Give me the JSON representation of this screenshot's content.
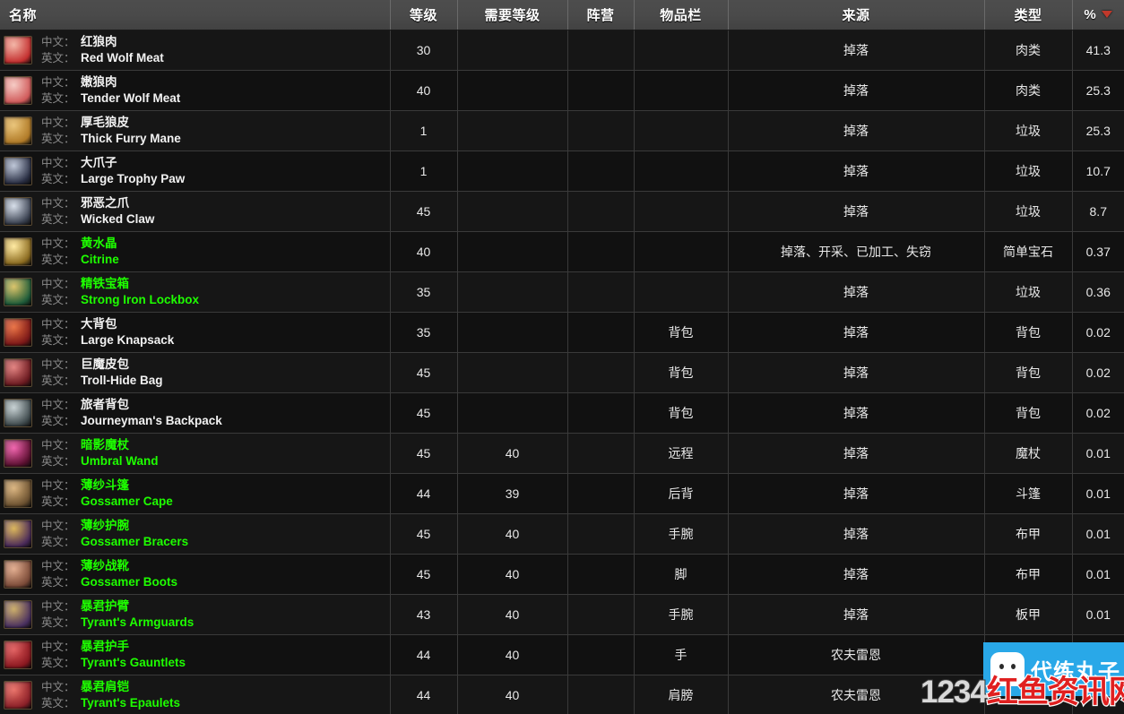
{
  "table": {
    "columns": [
      {
        "key": "name",
        "label": "名称"
      },
      {
        "key": "level",
        "label": "等级"
      },
      {
        "key": "req",
        "label": "需要等级"
      },
      {
        "key": "faction",
        "label": "阵营"
      },
      {
        "key": "slot",
        "label": "物品栏"
      },
      {
        "key": "source",
        "label": "来源"
      },
      {
        "key": "type",
        "label": "类型"
      },
      {
        "key": "pct",
        "label": "%"
      }
    ],
    "sort": {
      "column": "pct",
      "direction": "desc",
      "indicator": "sort-desc-triangle",
      "color": "#c0392b"
    },
    "row_labels": {
      "cn": "中文：",
      "en": "英文："
    },
    "quality_colors": {
      "common": "#f2f2f2",
      "uncommon": "#1eff00"
    },
    "rows": [
      {
        "cn": "红狼肉",
        "en": "Red Wolf Meat",
        "quality": "common",
        "level": "30",
        "req": "",
        "faction": "",
        "slot": "",
        "source": "掉落",
        "type": "肉类",
        "pct": "41.3",
        "icon": {
          "a": "#c43030",
          "b": "#f2b0a0"
        }
      },
      {
        "cn": "嫩狼肉",
        "en": "Tender Wolf Meat",
        "quality": "common",
        "level": "40",
        "req": "",
        "faction": "",
        "slot": "",
        "source": "掉落",
        "type": "肉类",
        "pct": "25.3",
        "icon": {
          "a": "#d05a5a",
          "b": "#f5c7c0"
        }
      },
      {
        "cn": "厚毛狼皮",
        "en": "Thick Furry Mane",
        "quality": "common",
        "level": "1",
        "req": "",
        "faction": "",
        "slot": "",
        "source": "掉落",
        "type": "垃圾",
        "pct": "25.3",
        "icon": {
          "a": "#b07a28",
          "b": "#e8c070"
        }
      },
      {
        "cn": "大爪子",
        "en": "Large Trophy Paw",
        "quality": "common",
        "level": "1",
        "req": "",
        "faction": "",
        "slot": "",
        "source": "掉落",
        "type": "垃圾",
        "pct": "10.7",
        "icon": {
          "a": "#2a2f44",
          "b": "#b9c2d4"
        }
      },
      {
        "cn": "邪恶之爪",
        "en": "Wicked Claw",
        "quality": "common",
        "level": "45",
        "req": "",
        "faction": "",
        "slot": "",
        "source": "掉落",
        "type": "垃圾",
        "pct": "8.7",
        "icon": {
          "a": "#3a4150",
          "b": "#d4dce8"
        }
      },
      {
        "cn": "黄水晶",
        "en": "Citrine",
        "quality": "uncommon",
        "level": "40",
        "req": "",
        "faction": "",
        "slot": "",
        "source": "掉落、开采、已加工、失窃",
        "type": "简单宝石",
        "pct": "0.37",
        "icon": {
          "a": "#8a6a20",
          "b": "#ffe89a"
        }
      },
      {
        "cn": "精铁宝箱",
        "en": "Strong Iron Lockbox",
        "quality": "uncommon",
        "level": "35",
        "req": "",
        "faction": "",
        "slot": "",
        "source": "掉落",
        "type": "垃圾",
        "pct": "0.36",
        "icon": {
          "a": "#1f5c3a",
          "b": "#d8c060"
        }
      },
      {
        "cn": "大背包",
        "en": "Large Knapsack",
        "quality": "common",
        "level": "35",
        "req": "",
        "faction": "",
        "slot": "背包",
        "source": "掉落",
        "type": "背包",
        "pct": "0.02",
        "icon": {
          "a": "#7a1818",
          "b": "#e86a3a"
        }
      },
      {
        "cn": "巨魔皮包",
        "en": "Troll-Hide Bag",
        "quality": "common",
        "level": "45",
        "req": "",
        "faction": "",
        "slot": "背包",
        "source": "掉落",
        "type": "背包",
        "pct": "0.02",
        "icon": {
          "a": "#6a1a20",
          "b": "#e07a78"
        }
      },
      {
        "cn": "旅者背包",
        "en": "Journeyman's Backpack",
        "quality": "common",
        "level": "45",
        "req": "",
        "faction": "",
        "slot": "背包",
        "source": "掉落",
        "type": "背包",
        "pct": "0.02",
        "icon": {
          "a": "#3f4a4d",
          "b": "#c3ced0"
        }
      },
      {
        "cn": "暗影魔杖",
        "en": "Umbral Wand",
        "quality": "uncommon",
        "level": "45",
        "req": "40",
        "faction": "",
        "slot": "远程",
        "source": "掉落",
        "type": "魔杖",
        "pct": "0.01",
        "icon": {
          "a": "#5a1030",
          "b": "#ef5aa8"
        }
      },
      {
        "cn": "薄纱斗篷",
        "en": "Gossamer Cape",
        "quality": "uncommon",
        "level": "44",
        "req": "39",
        "faction": "",
        "slot": "后背",
        "source": "掉落",
        "type": "斗篷",
        "pct": "0.01",
        "icon": {
          "a": "#6a5030",
          "b": "#d8b078"
        }
      },
      {
        "cn": "薄纱护腕",
        "en": "Gossamer Bracers",
        "quality": "uncommon",
        "level": "45",
        "req": "40",
        "faction": "",
        "slot": "手腕",
        "source": "掉落",
        "type": "布甲",
        "pct": "0.01",
        "icon": {
          "a": "#4a2a5a",
          "b": "#d8b050"
        }
      },
      {
        "cn": "薄纱战靴",
        "en": "Gossamer Boots",
        "quality": "uncommon",
        "level": "45",
        "req": "40",
        "faction": "",
        "slot": "脚",
        "source": "掉落",
        "type": "布甲",
        "pct": "0.01",
        "icon": {
          "a": "#7a4a38",
          "b": "#e0a888"
        }
      },
      {
        "cn": "暴君护臂",
        "en": "Tyrant's Armguards",
        "quality": "uncommon",
        "level": "43",
        "req": "40",
        "faction": "",
        "slot": "手腕",
        "source": "掉落",
        "type": "板甲",
        "pct": "0.01",
        "icon": {
          "a": "#4a3060",
          "b": "#c8a860"
        }
      },
      {
        "cn": "暴君护手",
        "en": "Tyrant's Gauntlets",
        "quality": "uncommon",
        "level": "44",
        "req": "40",
        "faction": "",
        "slot": "手",
        "source": "农夫雷恩",
        "type": "",
        "pct": "",
        "icon": {
          "a": "#8a1820",
          "b": "#e05858"
        }
      },
      {
        "cn": "暴君肩铠",
        "en": "Tyrant's Epaulets",
        "quality": "uncommon",
        "level": "44",
        "req": "40",
        "faction": "",
        "slot": "肩膀",
        "source": "农夫雷恩",
        "type": "",
        "pct": "",
        "icon": {
          "a": "#8a2028",
          "b": "#e86a60"
        }
      }
    ]
  },
  "watermarks": {
    "logo": {
      "text": "代练丸子",
      "background": "#29a8e8",
      "icon": "ghost-avatar-icon"
    },
    "band": {
      "number": "1234",
      "site": "红鱼资讯网",
      "number_color": "#d9d9d9",
      "site_color": "#e02020"
    }
  }
}
